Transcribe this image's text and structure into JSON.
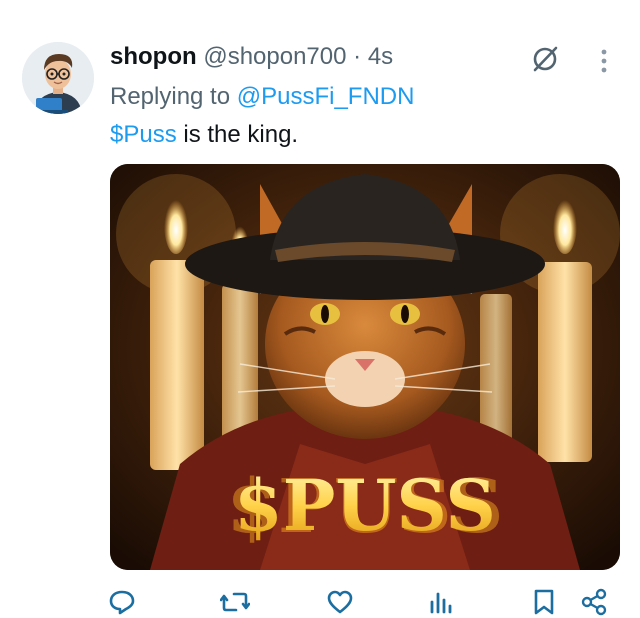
{
  "tweet": {
    "display_name": "shopon",
    "handle": "@shopon700",
    "separator": "·",
    "time": "4s",
    "reply_prefix": "Replying to",
    "reply_to": "@PussFi_FNDN",
    "cashtag": "$Puss",
    "text_rest": " is the king.",
    "image_text": "$PUSS"
  },
  "icons": {
    "grok": "grok-icon",
    "more": "more-vertical-icon",
    "reply": "reply-icon",
    "retweet": "retweet-icon",
    "like": "heart-icon",
    "views": "views-icon",
    "bookmark": "bookmark-icon",
    "share": "share-icon"
  },
  "colors": {
    "link": "#1d9bf0",
    "secondary_text": "#536471",
    "primary_text": "#0f1419",
    "icon_blue": "#1d6ea0"
  }
}
